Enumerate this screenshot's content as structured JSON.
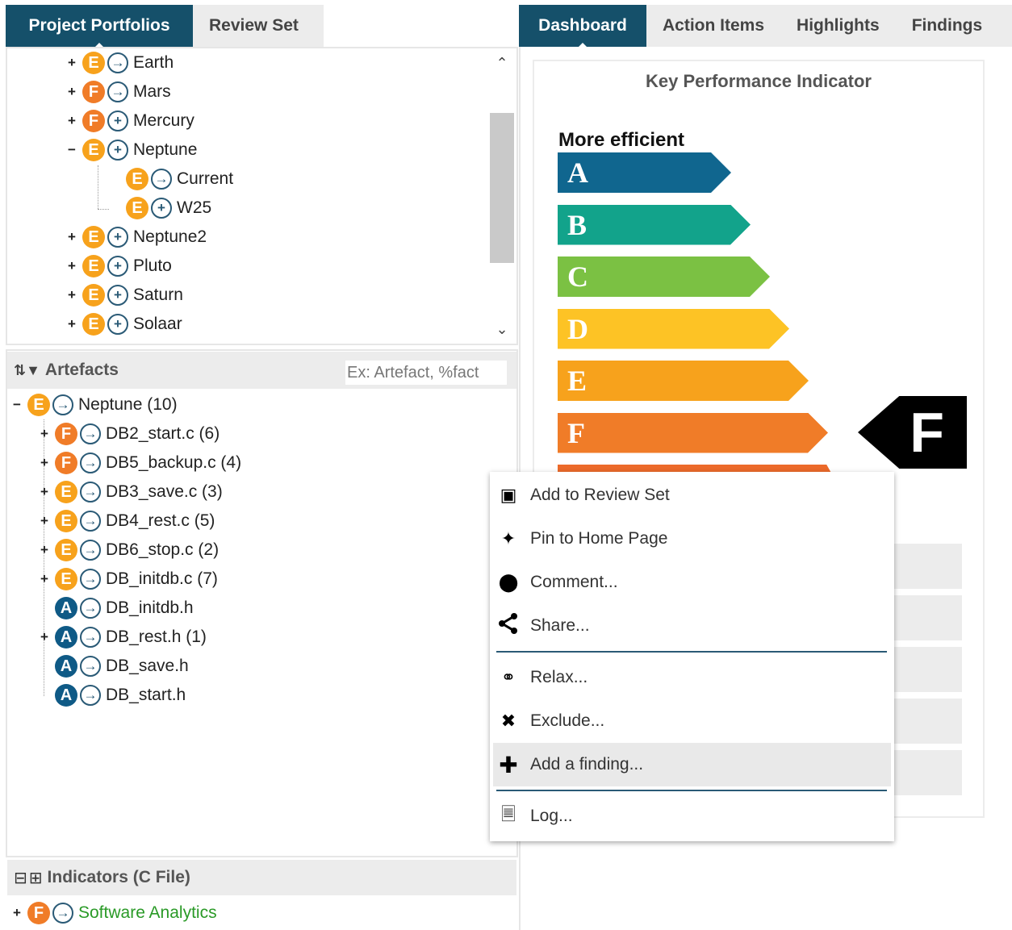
{
  "left_tabs": [
    {
      "label": "Project Portfolios",
      "active": true
    },
    {
      "label": "Review Set",
      "active": false
    }
  ],
  "right_tabs": [
    {
      "label": "Dashboard",
      "active": true
    },
    {
      "label": "Action Items",
      "active": false
    },
    {
      "label": "Highlights",
      "active": false
    },
    {
      "label": "Findings",
      "active": false
    }
  ],
  "portfolio_tree": [
    {
      "expander": "+",
      "rating": "E",
      "icon": "arrow-right",
      "label": "Earth"
    },
    {
      "expander": "+",
      "rating": "F",
      "icon": "arrow-right",
      "label": "Mars"
    },
    {
      "expander": "+",
      "rating": "F",
      "icon": "plus",
      "label": "Mercury"
    },
    {
      "expander": "−",
      "rating": "E",
      "icon": "plus",
      "label": "Neptune"
    },
    {
      "expander": "",
      "rating": "E",
      "icon": "arrow-right",
      "label": "Current",
      "selected": true
    },
    {
      "expander": "",
      "rating": "E",
      "icon": "plus",
      "label": "W25"
    },
    {
      "expander": "+",
      "rating": "E",
      "icon": "plus",
      "label": "Neptune2"
    },
    {
      "expander": "+",
      "rating": "E",
      "icon": "plus",
      "label": "Pluto"
    },
    {
      "expander": "+",
      "rating": "E",
      "icon": "plus",
      "label": "Saturn"
    },
    {
      "expander": "+",
      "rating": "E",
      "icon": "plus",
      "label": "Solaar"
    }
  ],
  "artefacts": {
    "title": "Artefacts",
    "filter_placeholder": "Ex: Artefact, %fact",
    "root": {
      "expander": "−",
      "rating": "E",
      "label": "Neptune (10)"
    },
    "items": [
      {
        "expander": "+",
        "rating": "F",
        "label": "DB2_start.c (6)"
      },
      {
        "expander": "+",
        "rating": "F",
        "label": "DB5_backup.c (4)",
        "selected": true
      },
      {
        "expander": "+",
        "rating": "E",
        "label": "DB3_save.c (3)"
      },
      {
        "expander": "+",
        "rating": "E",
        "label": "DB4_rest.c (5)"
      },
      {
        "expander": "+",
        "rating": "E",
        "label": "DB6_stop.c (2)"
      },
      {
        "expander": "+",
        "rating": "E",
        "label": "DB_initdb.c (7)"
      },
      {
        "expander": "",
        "rating": "A",
        "label": "DB_initdb.h"
      },
      {
        "expander": "+",
        "rating": "A",
        "label": "DB_rest.h (1)"
      },
      {
        "expander": "",
        "rating": "A",
        "label": "DB_save.h"
      },
      {
        "expander": "",
        "rating": "A",
        "label": "DB_start.h"
      }
    ]
  },
  "indicators": {
    "title": "Indicators (C File)",
    "items": [
      {
        "expander": "+",
        "rating": "F",
        "label": "Software Analytics"
      }
    ]
  },
  "kpi": {
    "title": "Key Performance Indicator",
    "caption": "More efficient",
    "grades": [
      {
        "letter": "A",
        "color": "#10668f"
      },
      {
        "letter": "B",
        "color": "#12a38b"
      },
      {
        "letter": "C",
        "color": "#7bc143"
      },
      {
        "letter": "D",
        "color": "#fdc325"
      },
      {
        "letter": "E",
        "color": "#f7a21c"
      },
      {
        "letter": "F",
        "color": "#f07c28"
      }
    ],
    "current_grade": "F"
  },
  "context_menu": {
    "items": [
      {
        "label": "Add to Review Set",
        "icon": "review-set-icon"
      },
      {
        "label": "Pin to Home Page",
        "icon": "pin-icon"
      },
      {
        "label": "Comment...",
        "icon": "comment-icon"
      },
      {
        "label": "Share...",
        "icon": "share-icon"
      },
      {
        "label": "Relax...",
        "icon": "relax-icon"
      },
      {
        "label": "Exclude...",
        "icon": "exclude-icon"
      },
      {
        "label": "Add a finding...",
        "icon": "add-icon",
        "hover": true
      },
      {
        "label": "Log...",
        "icon": "log-icon"
      }
    ]
  }
}
